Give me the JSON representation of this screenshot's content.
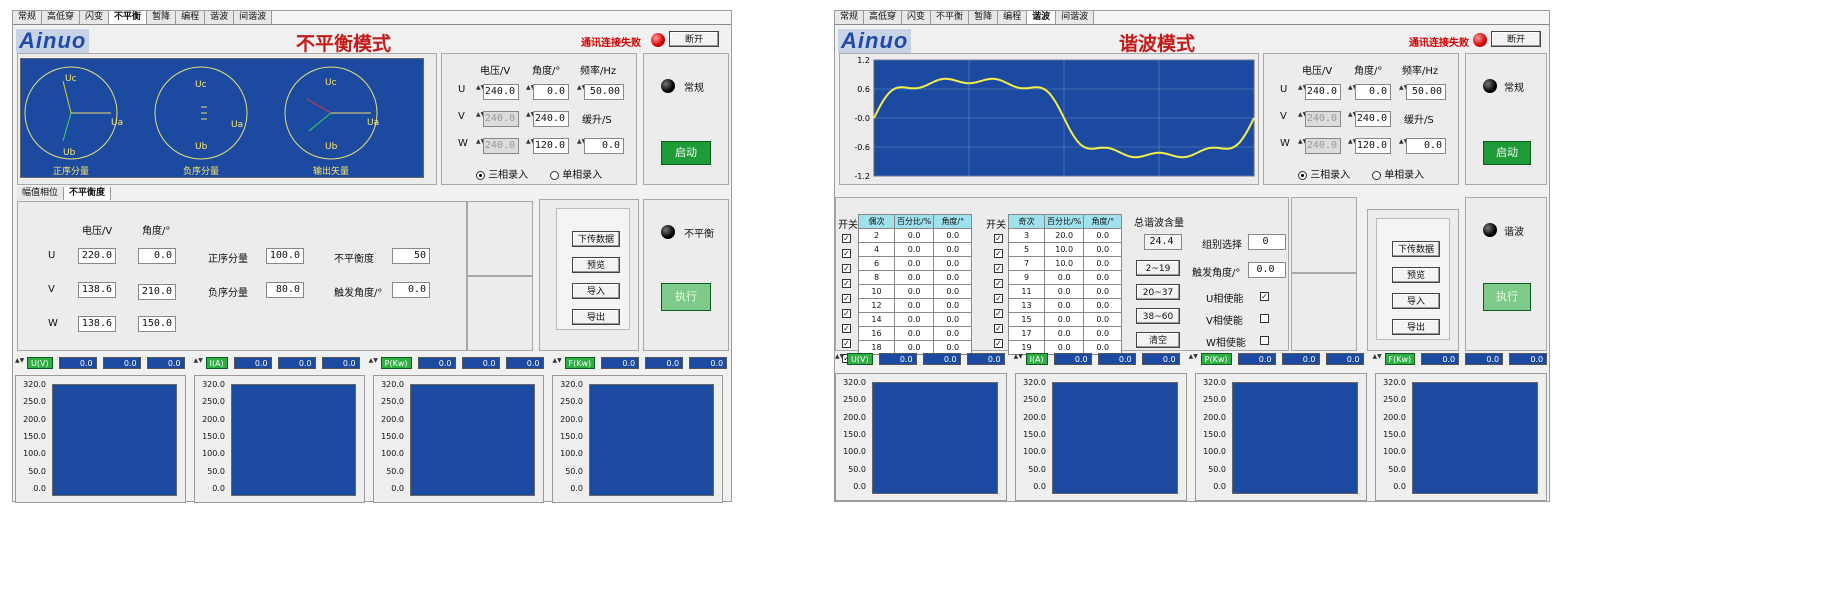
{
  "left": {
    "tabs": [
      "常规",
      "高低穿",
      "闪变",
      "不平衡",
      "暂降",
      "编程",
      "谐波",
      "间谐波"
    ],
    "active_tab": 3,
    "logo": "Ainuo",
    "mode_title": "不平衡模式",
    "comm_status": "通讯连接失败",
    "disconnect": "断开",
    "phasors": [
      "正序分量",
      "负序分量",
      "输出矢量"
    ],
    "phasor_labels": {
      "uc": "Uc",
      "ub": "Ub",
      "ua": "Ua"
    },
    "input": {
      "h_voltage": "电压/V",
      "h_angle": "角度/°",
      "h_freq": "频率/Hz",
      "ramp": "缓升/S",
      "rows": [
        {
          "ph": "U",
          "v": "240.0",
          "a": "0.0",
          "f": "50.00"
        },
        {
          "ph": "V",
          "v": "240.0",
          "a": "240.0",
          "f": ""
        },
        {
          "ph": "W",
          "v": "240.0",
          "a": "120.0",
          "f": "0.0"
        }
      ],
      "three": "三相录入",
      "single": "单相录入"
    },
    "ctrl": {
      "label": "常规",
      "start": "启动"
    },
    "subtabs": [
      "幅值相位",
      "不平衡度"
    ],
    "unb": {
      "h_v": "电压/V",
      "h_a": "角度/°",
      "rows": [
        {
          "ph": "U",
          "v": "220.0",
          "a": "0.0"
        },
        {
          "ph": "V",
          "v": "138.6",
          "a": "210.0"
        },
        {
          "ph": "W",
          "v": "138.6",
          "a": "150.0"
        }
      ],
      "pos": "正序分量",
      "pos_v": "100.0",
      "neg": "负序分量",
      "neg_v": "80.0",
      "deg": "不平衡度",
      "deg_v": "50",
      "trig": "触发角度/°",
      "trig_v": "0.0"
    },
    "btns": [
      "下传数据",
      "预览",
      "导入",
      "导出"
    ],
    "exec": {
      "label": "不平衡",
      "run": "执行"
    }
  },
  "right": {
    "tabs": [
      "常规",
      "高低穿",
      "闪变",
      "不平衡",
      "暂降",
      "编程",
      "谐波",
      "间谐波"
    ],
    "active_tab": 6,
    "logo": "Ainuo",
    "mode_title": "谐波模式",
    "comm_status": "通讯连接失败",
    "disconnect": "断开",
    "wave_y": [
      "1.2",
      "0.6",
      "-0.0",
      "-0.6",
      "-1.2"
    ],
    "input": {
      "h_voltage": "电压/V",
      "h_angle": "角度/°",
      "h_freq": "频率/Hz",
      "ramp": "缓升/S",
      "rows": [
        {
          "ph": "U",
          "v": "240.0",
          "a": "0.0",
          "f": "50.00"
        },
        {
          "ph": "V",
          "v": "240.0",
          "a": "240.0",
          "f": ""
        },
        {
          "ph": "W",
          "v": "240.0",
          "a": "120.0",
          "f": "0.0"
        }
      ],
      "three": "三相录入",
      "single": "单相录入"
    },
    "ctrl": {
      "label": "常规",
      "start": "启动"
    },
    "switch": "开关",
    "even": {
      "h": [
        "偶次",
        "百分比/%",
        "角度/°"
      ],
      "rows": [
        [
          "2",
          "0.0",
          "0.0"
        ],
        [
          "4",
          "0.0",
          "0.0"
        ],
        [
          "6",
          "0.0",
          "0.0"
        ],
        [
          "8",
          "0.0",
          "0.0"
        ],
        [
          "10",
          "0.0",
          "0.0"
        ],
        [
          "12",
          "0.0",
          "0.0"
        ],
        [
          "14",
          "0.0",
          "0.0"
        ],
        [
          "16",
          "0.0",
          "0.0"
        ],
        [
          "18",
          "0.0",
          "0.0"
        ]
      ]
    },
    "odd": {
      "h": [
        "奇次",
        "百分比/%",
        "角度/°"
      ],
      "rows": [
        [
          "3",
          "20.0",
          "0.0"
        ],
        [
          "5",
          "10.0",
          "0.0"
        ],
        [
          "7",
          "10.0",
          "0.0"
        ],
        [
          "9",
          "0.0",
          "0.0"
        ],
        [
          "11",
          "0.0",
          "0.0"
        ],
        [
          "13",
          "0.0",
          "0.0"
        ],
        [
          "15",
          "0.0",
          "0.0"
        ],
        [
          "17",
          "0.0",
          "0.0"
        ],
        [
          "19",
          "0.0",
          "0.0"
        ]
      ]
    },
    "thd": {
      "label": "总谐波含量",
      "value": "24.4",
      "group": "组别选择",
      "group_v": "0",
      "ranges": [
        "2~19",
        "20~37",
        "38~60",
        "清空"
      ],
      "trig": "触发角度/°",
      "trig_v": "0.0",
      "u": "U相使能",
      "v": "V相使能",
      "w": "W相使能"
    },
    "btns": [
      "下传数据",
      "预览",
      "导入",
      "导出"
    ],
    "exec": {
      "label": "谐波",
      "run": "执行"
    }
  },
  "meters": {
    "tags": [
      "U(V)",
      "I(A)",
      "P(Kw)",
      "F(Kw)"
    ],
    "tags_right": [
      "U(V)",
      "I(A)",
      "P(Kw)",
      "F(Kw)"
    ],
    "val": "0.0",
    "yticks": [
      "320.0",
      "250.0",
      "200.0",
      "150.0",
      "100.0",
      "50.0",
      "0.0"
    ]
  }
}
